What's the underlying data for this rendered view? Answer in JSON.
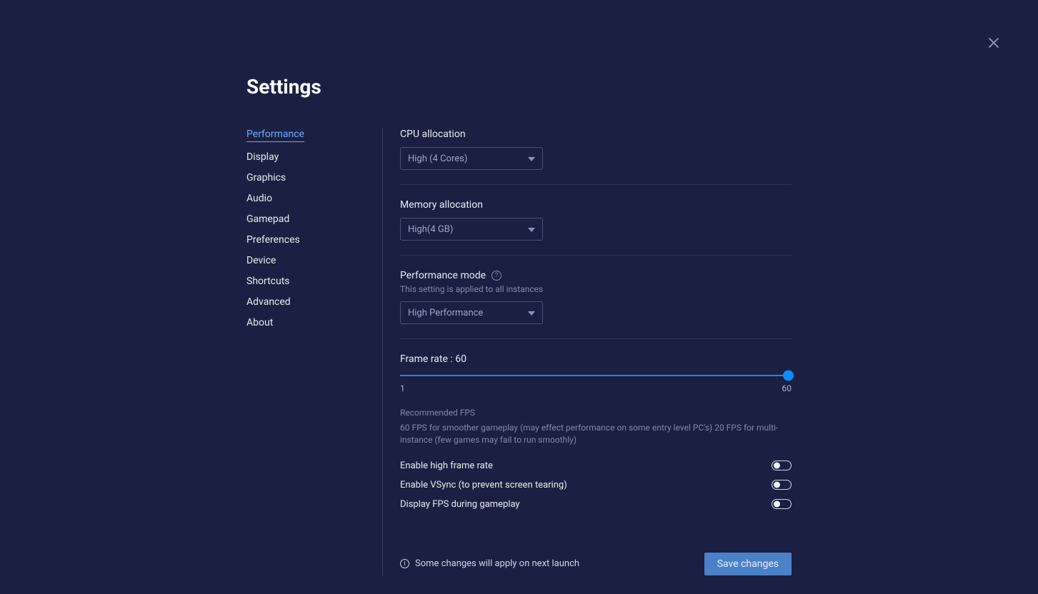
{
  "title": "Settings",
  "sidebar": {
    "items": [
      {
        "label": "Performance",
        "active": true
      },
      {
        "label": "Display"
      },
      {
        "label": "Graphics"
      },
      {
        "label": "Audio"
      },
      {
        "label": "Gamepad"
      },
      {
        "label": "Preferences"
      },
      {
        "label": "Device"
      },
      {
        "label": "Shortcuts"
      },
      {
        "label": "Advanced"
      },
      {
        "label": "About"
      }
    ]
  },
  "cpu": {
    "label": "CPU allocation",
    "value": "High (4 Cores)"
  },
  "memory": {
    "label": "Memory allocation",
    "value": "High(4 GB)"
  },
  "perfmode": {
    "label": "Performance mode",
    "subtext": "This setting is applied to all instances",
    "value": "High Performance"
  },
  "framerate": {
    "label": "Frame rate : 60",
    "min": "1",
    "max": "60",
    "note_title": "Recommended FPS",
    "note_body": "60 FPS for smoother gameplay (may effect performance on some entry level PC's) 20 FPS for multi-instance (few games may fail to run smoothly)"
  },
  "toggles": {
    "highfps": "Enable high frame rate",
    "vsync": "Enable VSync (to prevent screen tearing)",
    "displayfps": "Display FPS during gameplay"
  },
  "footer": {
    "note": "Some changes will apply on next launch",
    "save": "Save changes"
  }
}
